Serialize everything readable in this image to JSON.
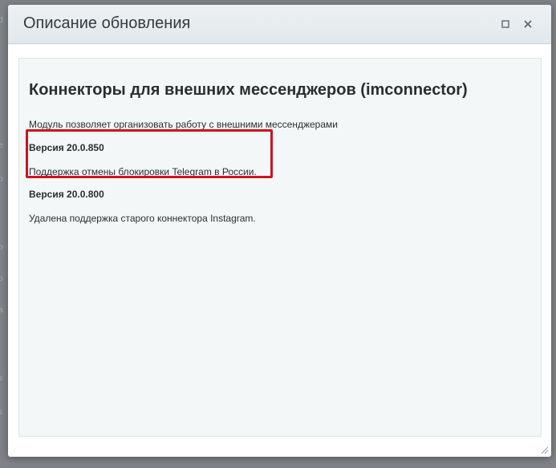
{
  "dialog": {
    "title": "Описание обновления",
    "maximize_icon": "maximize-icon",
    "close_icon": "close-icon"
  },
  "module": {
    "title": "Коннекторы для внешних мессенджеров (imconnector)",
    "description": "Модуль позволяет организовать работу с внешними мессенджерами"
  },
  "versions": [
    {
      "label": "Версия 20.0.850",
      "note": "Поддержка отмены блокировки Telegram в России."
    },
    {
      "label": "Версия 20.0.800",
      "note": "Удалена поддержка старого коннектора Instagram."
    }
  ],
  "colors": {
    "highlight": "#c8161d",
    "panel": "#f4f7f8",
    "titlebar": "#e6ebee"
  }
}
